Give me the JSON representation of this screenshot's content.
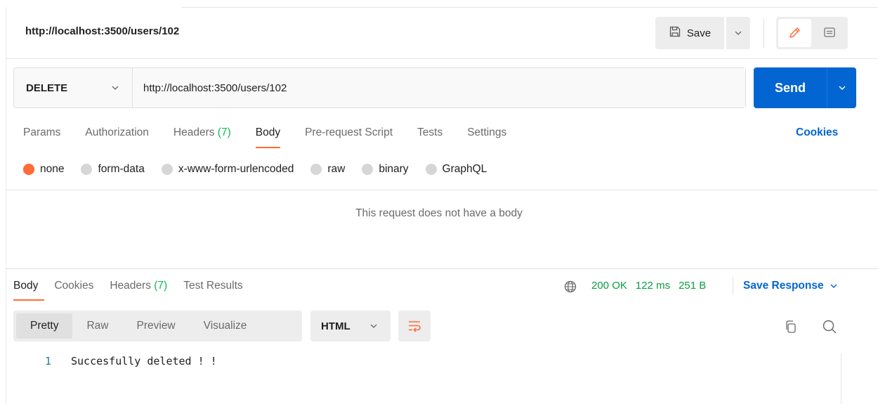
{
  "header": {
    "request_name": "http://localhost:3500/users/102",
    "save_label": "Save"
  },
  "request": {
    "method": "DELETE",
    "url": "http://localhost:3500/users/102",
    "send_label": "Send",
    "tabs": [
      {
        "label": "Params",
        "count": ""
      },
      {
        "label": "Authorization",
        "count": ""
      },
      {
        "label": "Headers",
        "count": "(7)"
      },
      {
        "label": "Body",
        "count": ""
      },
      {
        "label": "Pre-request Script",
        "count": ""
      },
      {
        "label": "Tests",
        "count": ""
      },
      {
        "label": "Settings",
        "count": ""
      }
    ],
    "active_tab": "Body",
    "cookies_label": "Cookies",
    "body_types": [
      "none",
      "form-data",
      "x-www-form-urlencoded",
      "raw",
      "binary",
      "GraphQL"
    ],
    "selected_body_type": "none",
    "no_body_message": "This request does not have a body"
  },
  "response": {
    "tabs": [
      {
        "label": "Body",
        "count": ""
      },
      {
        "label": "Cookies",
        "count": ""
      },
      {
        "label": "Headers",
        "count": "(7)"
      },
      {
        "label": "Test Results",
        "count": ""
      }
    ],
    "status": "200 OK",
    "time": "122 ms",
    "size": "251 B",
    "save_response_label": "Save Response",
    "view_modes": [
      "Pretty",
      "Raw",
      "Preview",
      "Visualize"
    ],
    "active_view_mode": "Pretty",
    "language": "HTML",
    "lines": [
      {
        "num": "1",
        "text": "Succesfully deleted ! !"
      }
    ]
  },
  "colors": {
    "accent": "#ff6c37",
    "primary": "#0265d2",
    "success": "#0a9e3f"
  }
}
